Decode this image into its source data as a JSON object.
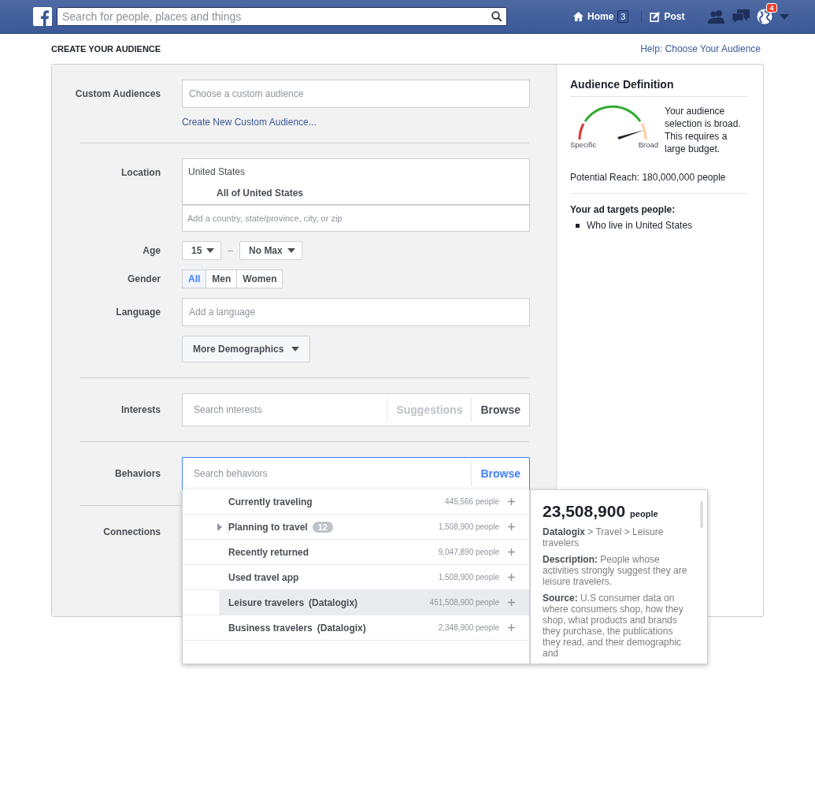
{
  "top_bar": {
    "search": {
      "placeholder": "Search for people, places and things"
    },
    "home": {
      "label": "Home",
      "badge": "3"
    },
    "post": {
      "label": "Post"
    },
    "notifications_badge": "4"
  },
  "page": {
    "title": "CREATE YOUR AUDIENCE",
    "help_link": "Help: Choose Your Audience"
  },
  "custom_audiences": {
    "label": "Custom Audiences",
    "placeholder": "Choose a custom audience",
    "link": "Create New Custom Audience..."
  },
  "location": {
    "label": "Location",
    "country": "United States",
    "scope": "All of United States",
    "placeholder": "Add a country, state/province, city, or zip"
  },
  "age": {
    "label": "Age",
    "min": "15",
    "separator": "–",
    "max": "No Max"
  },
  "gender": {
    "label": "Gender",
    "options": [
      {
        "label": "All",
        "selected": true
      },
      {
        "label": "Men",
        "selected": false
      },
      {
        "label": "Women",
        "selected": false
      }
    ]
  },
  "language": {
    "label": "Language",
    "placeholder": "Add a language"
  },
  "more_demographics": "More Demographics",
  "interests": {
    "label": "Interests",
    "placeholder": "Search interests",
    "suggestions": "Suggestions",
    "browse": "Browse"
  },
  "behaviors": {
    "label": "Behaviors",
    "placeholder": "Search behaviors",
    "browse": "Browse",
    "items": [
      {
        "name": "Currently traveling",
        "people": "445,566 people",
        "selected": false,
        "expandable": false
      },
      {
        "name": "Planning to travel",
        "count": "12",
        "people": "1,508,900 people",
        "selected": false,
        "expandable": true
      },
      {
        "name": "Recently returned",
        "people": "9,047,890 people",
        "selected": false,
        "expandable": false
      },
      {
        "name": "Used travel app",
        "people": "1,508,900 people",
        "selected": false,
        "expandable": false
      },
      {
        "name": "Leisure travelers",
        "source": "(Datalogix)",
        "people": "451,508,900 people",
        "selected": true,
        "expandable": false
      },
      {
        "name": "Business travelers",
        "source": "(Datalogix)",
        "people": "2,348,900 people",
        "selected": false,
        "expandable": false
      }
    ],
    "detail": {
      "reach": "23,508,900",
      "unit": "people",
      "path": "**Datalogix** > Travel > Leisure travelers",
      "description": "**Description:** People whose activities strongly suggest they are leisure travelers.",
      "source": "**Source:** U.S consumer data on where consumers shop, how they shop, what products and brands they purchase, the publications they read, and their demographic and"
    }
  },
  "connections": {
    "label": "Connections"
  },
  "audience_definition": {
    "title": "Audience Definition",
    "gauge_low": "Specific",
    "gauge_high": "Broad",
    "summary": "Your audience selection is broad. This requires a large budget.",
    "potential_reach": "Potential Reach: 180,000,000 people",
    "targets_heading": "Your ad targets people:",
    "targets": [
      "Who live in United States"
    ]
  }
}
